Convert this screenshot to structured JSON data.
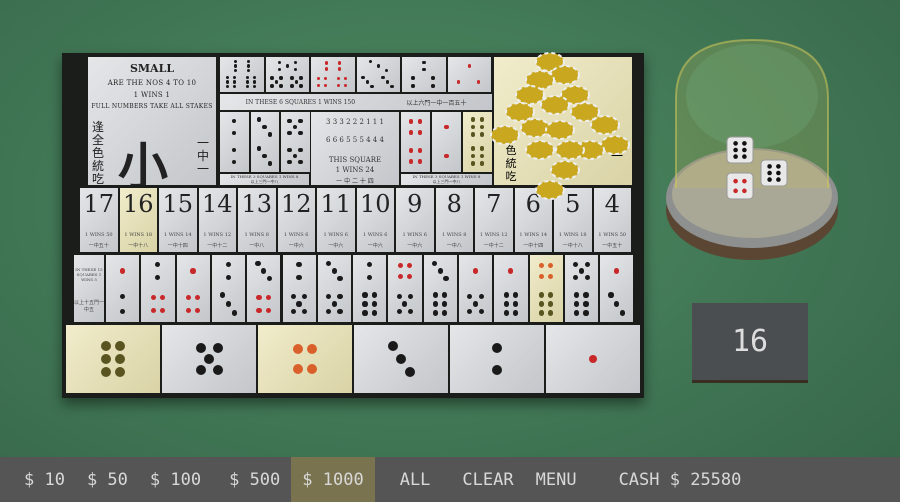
{
  "small_panel": {
    "title": "SMALL",
    "line1": "ARE THE NOS 4 TO 10",
    "line2": "1 WINS 1",
    "line3": "FULL NUMBERS TAKE ALL STAKES",
    "char": "小",
    "left_vert": "逢全色統吃",
    "right_vert": "一中一"
  },
  "triples": [
    6,
    5,
    4,
    3,
    2,
    1
  ],
  "triples_band": {
    "en": "IN THESE 6 SQUARES 1 WINS 150",
    "zh": "以上六門一中一百五十"
  },
  "doubles_left": [
    2,
    3,
    5
  ],
  "doubles_right": [
    4,
    1,
    6
  ],
  "doubles_band": {
    "en": "IN THESE 3 SQUARES 1 WINS 8",
    "zh": "以上三門一中八"
  },
  "any_triple": {
    "rows": [
      "3 3 3   2 2 2   1 1 1",
      "6 6 6   5 5 5   4 4 4"
    ],
    "line1": "THIS SQUARE",
    "line2": "1 WINS 24",
    "zh": "一 中 二 十 四"
  },
  "big_panel": {
    "left_vert": "全色統吃",
    "right_vert": "中一"
  },
  "totals": [
    {
      "n": "17",
      "wins": "1 WINS 50",
      "zh": "一中五十"
    },
    {
      "n": "16",
      "wins": "1 WINS 18",
      "zh": "一中十八",
      "hl": true
    },
    {
      "n": "15",
      "wins": "1 WINS 14",
      "zh": "一中十四"
    },
    {
      "n": "14",
      "wins": "1 WINS 12",
      "zh": "一中十二"
    },
    {
      "n": "13",
      "wins": "1 WINS 8",
      "zh": "一中八"
    },
    {
      "n": "12",
      "wins": "1 WINS 6",
      "zh": "一中六"
    },
    {
      "n": "11",
      "wins": "1 WINS 6",
      "zh": "一中六"
    },
    {
      "n": "10",
      "wins": "1 WINS 6",
      "zh": "一中六"
    },
    {
      "n": "9",
      "wins": "1 WINS 6",
      "zh": "一中六"
    },
    {
      "n": "8",
      "wins": "1 WINS 8",
      "zh": "一中八"
    },
    {
      "n": "7",
      "wins": "1 WINS 12",
      "zh": "一中十二"
    },
    {
      "n": "6",
      "wins": "1 WINS 14",
      "zh": "一中十四"
    },
    {
      "n": "5",
      "wins": "1 WINS 18",
      "zh": "一中十八"
    },
    {
      "n": "4",
      "wins": "1 WINS 50",
      "zh": "一中五十"
    }
  ],
  "pairs_label": {
    "en": "IN THESE 15 SQUARES 1 WINS 5",
    "zh": "以上十五門一中五"
  },
  "pairs": [
    [
      1,
      2
    ],
    [
      2,
      4
    ],
    [
      1,
      4
    ],
    [
      2,
      3
    ],
    [
      3,
      4
    ],
    [
      2,
      5
    ],
    [
      3,
      5
    ],
    [
      2,
      6
    ],
    [
      4,
      5
    ],
    [
      3,
      6
    ],
    [
      1,
      5
    ],
    [
      1,
      6
    ],
    [
      4,
      6
    ],
    [
      5,
      6
    ],
    [
      1,
      3
    ]
  ],
  "pairs_highlight": [
    4,
    6
  ],
  "singles": [
    6,
    5,
    4,
    3,
    2,
    1
  ],
  "singles_highlight": [
    6,
    4
  ],
  "dice_result": [
    6,
    6,
    4
  ],
  "result_total": "16",
  "bottom_bar": {
    "chips": [
      "$ 10",
      "$ 50",
      "$ 100",
      "$ 500",
      "$ 1000"
    ],
    "selected_chip": "$ 1000",
    "all": "ALL",
    "clear": "CLEAR",
    "menu": "MENU",
    "cash": "CASH $ 25580"
  },
  "colors": {
    "felt": "#3f7453",
    "red_pip": "#c8282a",
    "black_pip": "#1a1a1a",
    "highlight": "#ece6c0",
    "chip_gold": "#c9a820",
    "selected": "#7a7350"
  }
}
